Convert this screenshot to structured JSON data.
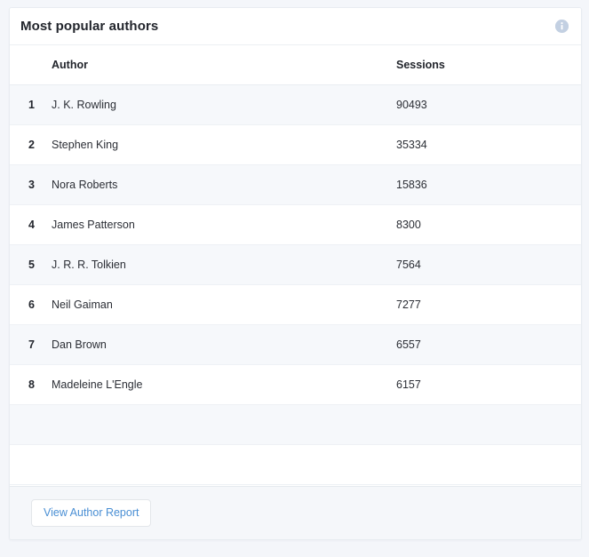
{
  "card": {
    "title": "Most popular authors",
    "info_icon": "info-icon"
  },
  "table": {
    "columns": {
      "rank": "",
      "author": "Author",
      "sessions": "Sessions"
    },
    "rows": [
      {
        "rank": "1",
        "author": "J. K. Rowling",
        "sessions": "90493"
      },
      {
        "rank": "2",
        "author": "Stephen King",
        "sessions": "35334"
      },
      {
        "rank": "3",
        "author": "Nora Roberts",
        "sessions": "15836"
      },
      {
        "rank": "4",
        "author": "James Patterson",
        "sessions": "8300"
      },
      {
        "rank": "5",
        "author": "J. R. R. Tolkien",
        "sessions": "7564"
      },
      {
        "rank": "6",
        "author": "Neil Gaiman",
        "sessions": "7277"
      },
      {
        "rank": "7",
        "author": "Dan Brown",
        "sessions": "6557"
      },
      {
        "rank": "8",
        "author": "Madeleine L'Engle",
        "sessions": "6157"
      },
      {
        "rank": "",
        "author": "",
        "sessions": ""
      },
      {
        "rank": "",
        "author": "",
        "sessions": ""
      }
    ]
  },
  "footer": {
    "report_button_label": "View Author Report"
  },
  "colors": {
    "page_background": "#f4f6fa",
    "card_background": "#ffffff",
    "row_alt_background": "#f6f8fb",
    "footer_background": "#f5f7fa",
    "link_blue": "#4a8fd4",
    "info_icon_fill": "#c3d0e2",
    "text_primary": "#22252c"
  }
}
